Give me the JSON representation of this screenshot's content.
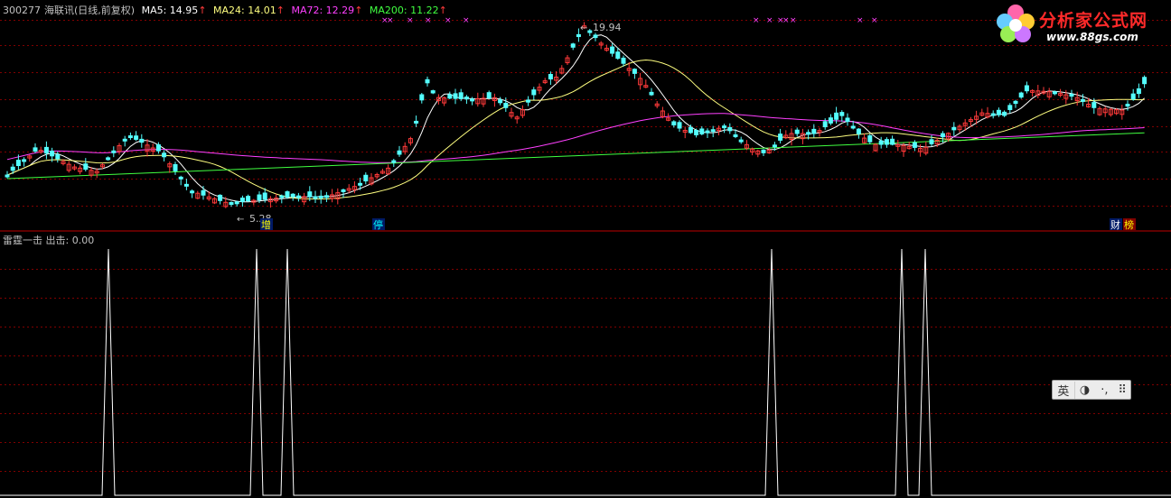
{
  "header": {
    "code": "300277",
    "name": "海联讯(日线,前复权)",
    "ma": [
      {
        "label": "MA5: 14.95",
        "arrow": "↑",
        "color": "#ffffff"
      },
      {
        "label": "MA24: 14.01",
        "arrow": "↑",
        "color": "#ffff80"
      },
      {
        "label": "MA72: 12.29",
        "arrow": "↑",
        "color": "#ff40ff"
      },
      {
        "label": "MA200: 11.22",
        "arrow": "↑",
        "color": "#40ff40"
      }
    ]
  },
  "main_chart": {
    "high_label": "19.94",
    "low_label": "5.28",
    "markers": [
      "增",
      "停",
      "财",
      "榜"
    ]
  },
  "sub_header": {
    "name": "雷霆一击",
    "value": "出击: 0.00"
  },
  "logo": {
    "text": "分析家公式网",
    "url": "www.88gs.com"
  },
  "ime": {
    "lang": "英",
    "moon_icon": "◑",
    "punct_icon": "·,",
    "keyboard_icon": "⠿"
  },
  "colors": {
    "up": "#ff3a3a",
    "down": "#54ffff",
    "ma5": "#ffffff",
    "ma24": "#ffff80",
    "ma72": "#ff40ff",
    "ma200": "#40ff40",
    "grid": "#800000",
    "signal": "#ffffff",
    "cross": "#ff40ff"
  },
  "signal_count": 6
}
